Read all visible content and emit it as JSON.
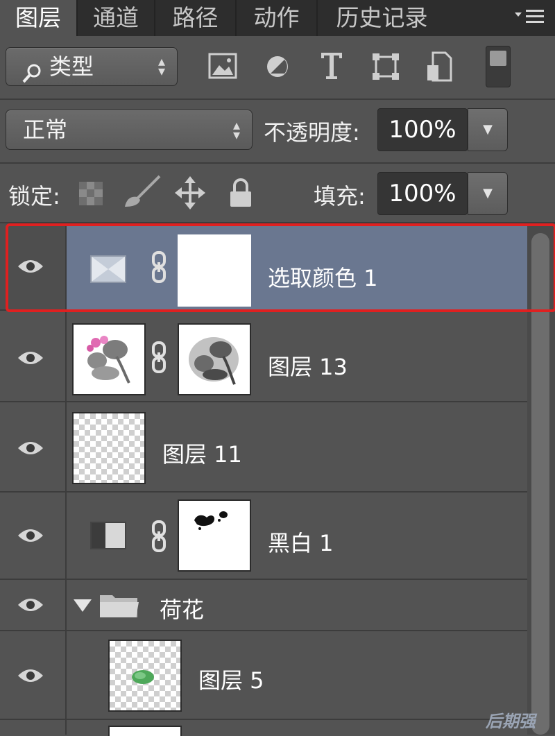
{
  "tabs": [
    {
      "label": "图层",
      "active": true
    },
    {
      "label": "通道",
      "active": false
    },
    {
      "label": "路径",
      "active": false
    },
    {
      "label": "动作",
      "active": false
    },
    {
      "label": "历史记录",
      "active": false
    }
  ],
  "filter": {
    "kind_label": "类型",
    "icons": [
      "image-filter-icon",
      "adjustment-filter-icon",
      "type-filter-icon",
      "shape-filter-icon",
      "smart-object-filter-icon",
      "filter-toggle-icon"
    ]
  },
  "blend": {
    "mode": "正常",
    "opacity_label": "不透明度:",
    "opacity_value": "100%"
  },
  "lock": {
    "label": "锁定:",
    "icons": [
      "lock-transparent-icon",
      "lock-pixels-icon",
      "lock-position-icon",
      "lock-all-icon"
    ],
    "fill_label": "填充:",
    "fill_value": "100%"
  },
  "layers": [
    {
      "name": "选取颜色 1",
      "type": "adjustment",
      "selected": true,
      "visible": true
    },
    {
      "name": "图层 13",
      "type": "masked-pixel",
      "selected": false,
      "visible": true
    },
    {
      "name": "图层 11",
      "type": "pixel",
      "selected": false,
      "visible": true
    },
    {
      "name": "黑白 1",
      "type": "adjustment",
      "selected": false,
      "visible": true
    },
    {
      "name": "荷花",
      "type": "group",
      "expanded": true,
      "visible": true
    },
    {
      "name": "图层 5",
      "type": "pixel",
      "selected": false,
      "visible": true
    }
  ],
  "watermark": "后期强"
}
